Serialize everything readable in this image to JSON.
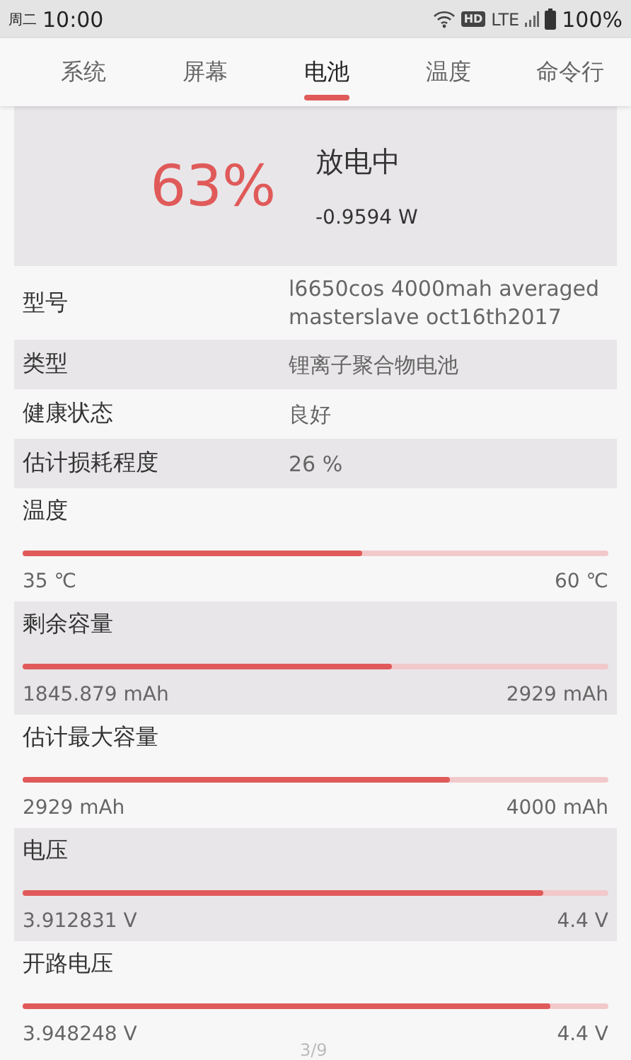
{
  "status_bar": {
    "day": "周二",
    "time": "10:00",
    "hd": "HD",
    "network": "LTE",
    "battery": "100%"
  },
  "tabs": [
    {
      "label": "系统",
      "selected": false
    },
    {
      "label": "屏幕",
      "selected": false
    },
    {
      "label": "电池",
      "selected": true
    },
    {
      "label": "温度",
      "selected": false
    },
    {
      "label": "命令行",
      "selected": false
    }
  ],
  "summary": {
    "percent": "63%",
    "state": "放电中",
    "power": "-0.9594 W"
  },
  "info_rows": [
    {
      "label": "型号",
      "value": "l6650cos 4000mah averaged masterslave oct16th2017"
    },
    {
      "label": "类型",
      "value": "锂离子聚合物电池"
    },
    {
      "label": "健康状态",
      "value": "良好"
    },
    {
      "label": "估计损耗程度",
      "value": "26 %"
    }
  ],
  "meter_rows": [
    {
      "label": "温度",
      "level": 0.58,
      "current": "35 ℃",
      "max": "60 ℃"
    },
    {
      "label": "剩余容量",
      "level": 0.63,
      "current": "1845.879 mAh",
      "max": "2929 mAh"
    },
    {
      "label": "估计最大容量",
      "level": 0.73,
      "current": "2929 mAh",
      "max": "4000 mAh"
    },
    {
      "label": "电压",
      "level": 0.89,
      "current": "3.912831 V",
      "max": "4.4 V"
    },
    {
      "label": "开路电压",
      "level": 0.9,
      "current": "3.948248 V",
      "max": "4.4 V"
    }
  ],
  "page_indicator": "3/9"
}
